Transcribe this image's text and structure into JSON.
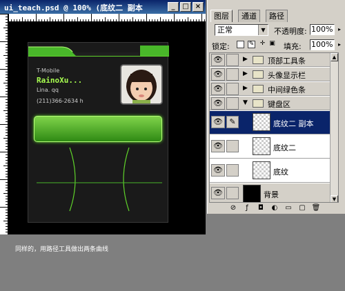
{
  "document_window": {
    "title": "ui_teach.psd @ 100% (底纹二 副本",
    "buttons": {
      "minimize": "_",
      "restore": "□",
      "close": "×"
    }
  },
  "phone_card": {
    "operator": "T-Mobile",
    "name": "RainoXu...",
    "subtitle": "Lina. qq",
    "phone": "(211)366-2634 h"
  },
  "caption": "同样的，用路径工具做出两条曲线",
  "layers_panel": {
    "tabs": [
      "图层",
      "通道",
      "路径"
    ],
    "active_tab": 0,
    "blend_mode": "正常",
    "opacity_label": "不透明度:",
    "opacity_value": "100%",
    "lock_label": "锁定:",
    "fill_label": "填充:",
    "fill_value": "100%",
    "layers": [
      {
        "name": "顶部工具条",
        "type": "group",
        "collapsed": true
      },
      {
        "name": "头像显示栏",
        "type": "group",
        "collapsed": true
      },
      {
        "name": "中间绿色条",
        "type": "group",
        "collapsed": true
      },
      {
        "name": "键盘区",
        "type": "group",
        "collapsed": false
      },
      {
        "name": "底纹二 副本",
        "type": "layer",
        "selected": true
      },
      {
        "name": "底纹二",
        "type": "layer"
      },
      {
        "name": "底纹",
        "type": "layer"
      },
      {
        "name": "背景",
        "type": "background"
      }
    ]
  },
  "colors": {
    "accent_green": "#7fd34a",
    "selection_blue": "#0a246a",
    "title_text_green": "#a8ff50"
  }
}
